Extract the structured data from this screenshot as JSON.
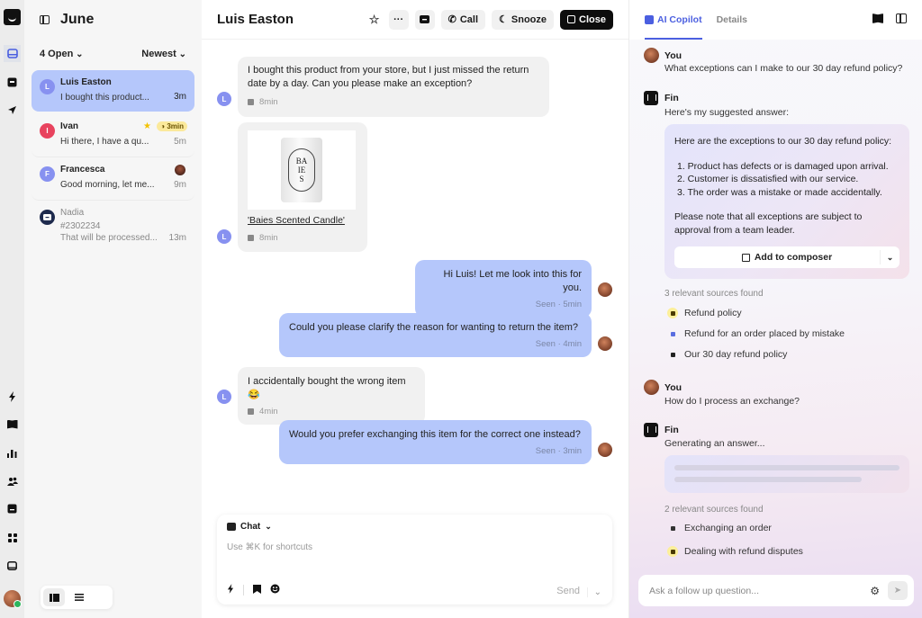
{
  "rail": {
    "icons": [
      "inbox-icon",
      "ticket-icon",
      "outbound-icon",
      "bolt-icon",
      "book-icon",
      "reports-icon",
      "contacts-icon",
      "messages-icon",
      "apps-icon",
      "screen-icon"
    ]
  },
  "inbox": {
    "title": "June",
    "filter_label": "4 Open",
    "sort_label": "Newest",
    "conversations": [
      {
        "initial": "L",
        "name": "Luis Easton",
        "preview": "I bought this product...",
        "time": "3m",
        "color": "#8791f0"
      },
      {
        "initial": "I",
        "name": "Ivan",
        "preview": "Hi there, I have a qu...",
        "time": "5m",
        "color": "#e8435e",
        "badge": "3min"
      },
      {
        "initial": "F",
        "name": "Francesca",
        "preview": "Good morning, let me...",
        "time": "9m",
        "color": "#8791f0"
      },
      {
        "initial": "",
        "name": "Nadia",
        "ticket": "#2302234",
        "preview": "That will be processed...",
        "time": "13m",
        "color": "#1e2a4d"
      }
    ]
  },
  "conversation": {
    "title": "Luis Easton",
    "actions": {
      "call": "Call",
      "snooze": "Snooze",
      "close": "Close",
      "more": "···"
    },
    "customer_initial": "L",
    "messages": [
      {
        "from": "customer",
        "text": "I bought this product from your store, but I just missed the return date by a day. Can you please make an exception?",
        "meta": "8min"
      },
      {
        "from": "customer",
        "type": "product",
        "product_name": "'Baies Scented Candle'",
        "product_label": "BA IES",
        "meta": "8min"
      },
      {
        "from": "agent",
        "text": "Hi Luis! Let me look into this for you.",
        "meta": "Seen · 5min"
      },
      {
        "from": "agent",
        "text": "Could you please clarify the reason for wanting to return the item?",
        "meta": "Seen · 4min"
      },
      {
        "from": "customer",
        "text": "I accidentally bought the wrong item 😂",
        "meta": "4min"
      },
      {
        "from": "agent",
        "text": "Would you prefer exchanging this item for the correct one instead?",
        "meta": "Seen · 3min"
      }
    ],
    "composer": {
      "mode": "Chat",
      "placeholder": "Use ⌘K for shortcuts",
      "send_label": "Send"
    }
  },
  "copilot": {
    "tabs": [
      "AI Copilot",
      "Details"
    ],
    "active_tab": "AI Copilot",
    "thread": {
      "q1_author": "You",
      "q1_text": "What exceptions can I make to our 30 day refund policy?",
      "a1_author": "Fin",
      "a1_intro": "Here's my suggested answer:",
      "a1_heading": "Here are the exceptions to our 30 day refund policy:",
      "a1_items": [
        "1. Product has defects or is damaged upon arrival.",
        "2. Customer is dissatisfied with our service.",
        "3. The order was a mistake or made accidentally."
      ],
      "a1_note": "Please note that all exceptions are subject to approval from a team leader.",
      "add_to_composer": "Add to composer",
      "sources1_title": "3 relevant sources found",
      "sources1": [
        "Refund policy",
        "Refund for an order placed by mistake",
        "Our 30 day refund policy"
      ],
      "q2_author": "You",
      "q2_text": "How do I process an exchange?",
      "a2_author": "Fin",
      "a2_status": "Generating an answer...",
      "sources2_title": "2 relevant sources found",
      "sources2": [
        "Exchanging an order",
        "Dealing with refund disputes"
      ]
    },
    "ask_placeholder": "Ask a follow up question..."
  }
}
